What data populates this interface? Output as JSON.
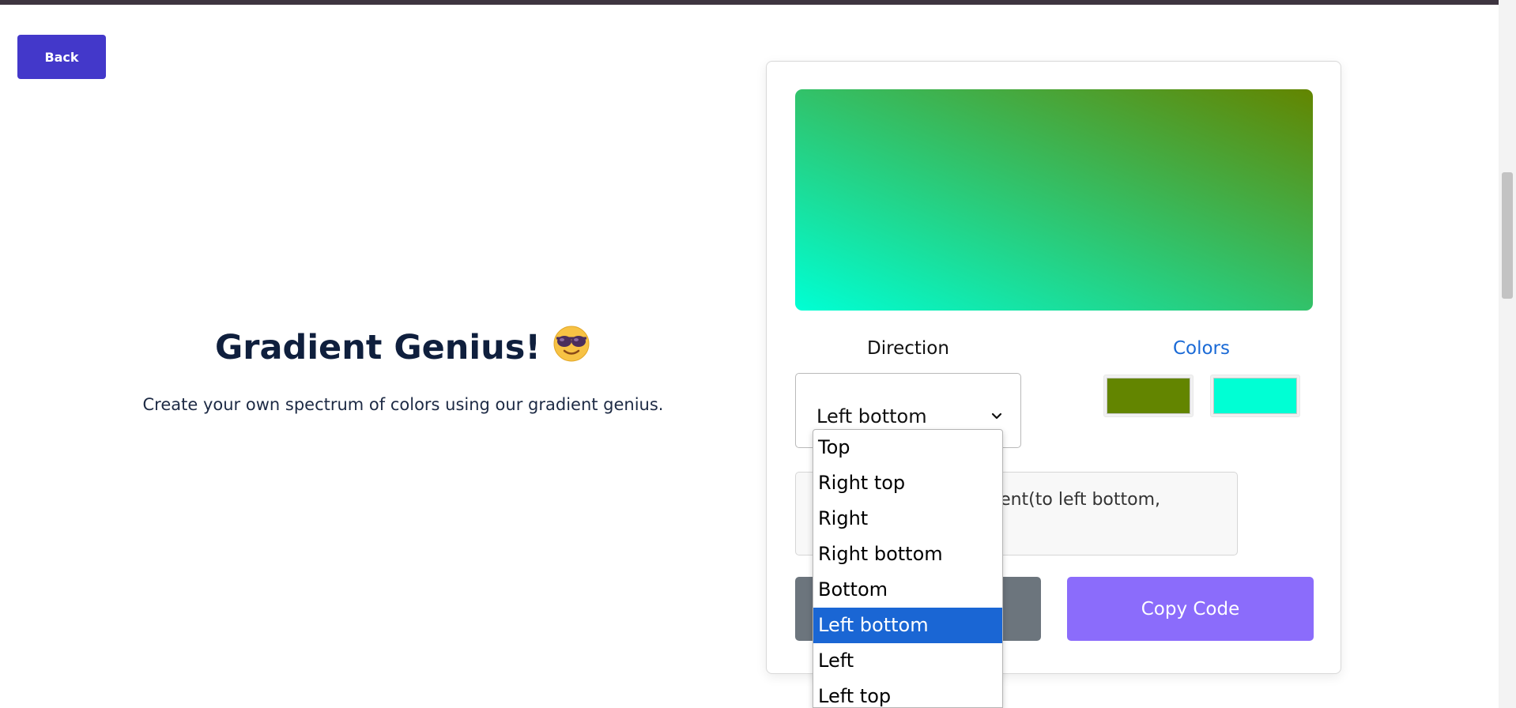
{
  "header": {
    "back_label": "Back"
  },
  "hero": {
    "title": "Gradient Genius!",
    "emoji_icon": "sunglasses-face-icon",
    "subtitle": "Create your own spectrum of colors using our gradient genius."
  },
  "generator": {
    "preview": {
      "direction": "to left bottom",
      "color1": "#638500",
      "color2": "#00ffd4"
    },
    "direction_label": "Direction",
    "colors_label": "Colors",
    "selected_direction": "Left bottom",
    "chevron_icon": "chevron-down-icon",
    "color_swatches": [
      "#638500",
      "#00ffd4"
    ],
    "code_visible_text": "dient(to left bottom,",
    "random_button_label": "",
    "copy_button_label": "Copy Code"
  },
  "direction_dropdown": {
    "options": [
      "Top",
      "Right top",
      "Right",
      "Right bottom",
      "Bottom",
      "Left bottom",
      "Left",
      "Left top"
    ],
    "selected_index": 5
  },
  "colors": {
    "primary_button": "#4338ca",
    "copy_button": "#8b6cfb",
    "random_button": "#6c757d",
    "selected_option": "#1a66d4",
    "colors_label": "#1a6ad6"
  }
}
